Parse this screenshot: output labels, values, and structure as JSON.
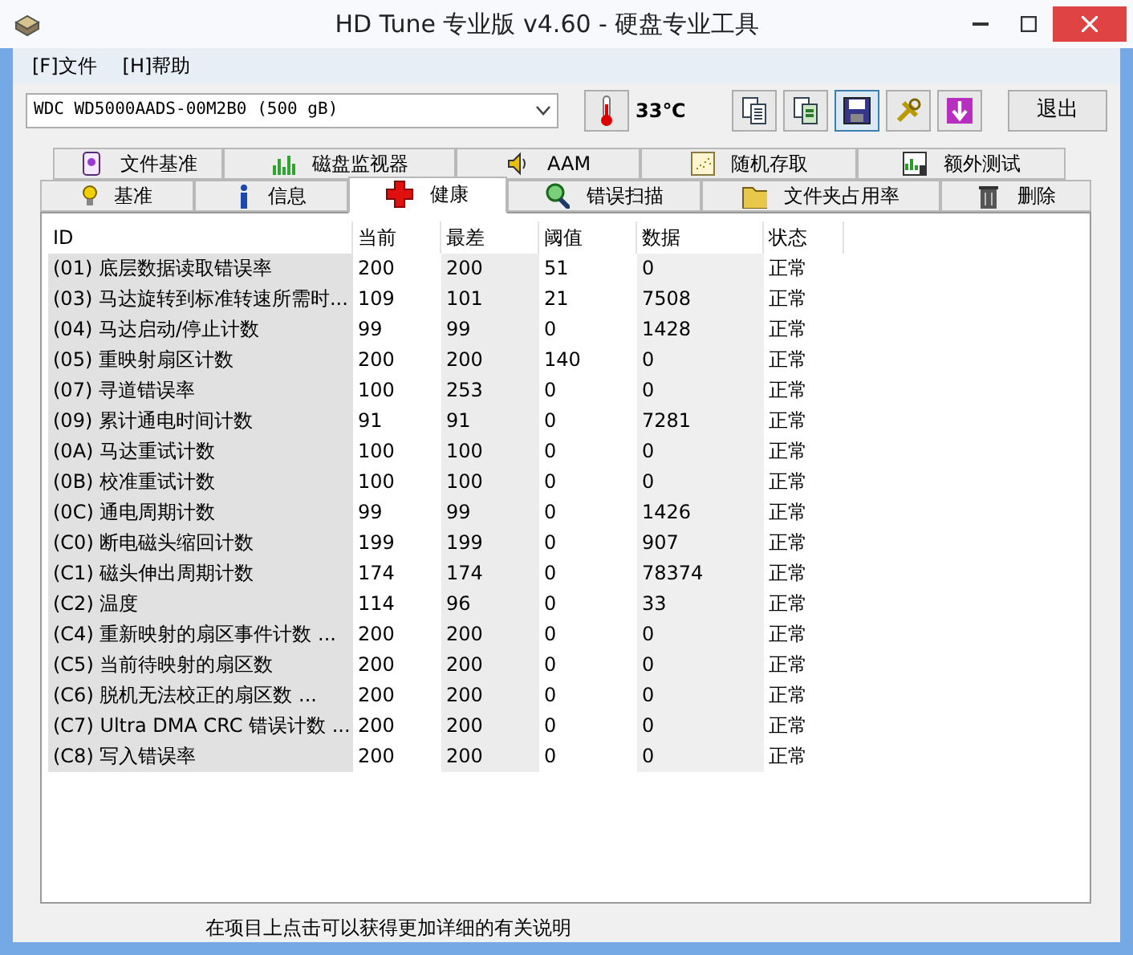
{
  "window": {
    "title": "HD Tune 专业版 v4.60 - 硬盘专业工具"
  },
  "menu": [
    {
      "label": "[F]文件"
    },
    {
      "label": "[H]帮助"
    }
  ],
  "toolbar": {
    "drive": "WDC WD5000AADS-00M2B0 (500 gB)",
    "temperature": "33℃",
    "exit_button": "退出"
  },
  "tab_rows": [
    {
      "tabs": [
        {
          "label": "文件基准",
          "selected": false
        },
        {
          "label": "磁盘监视器",
          "selected": false
        },
        {
          "label": "AAM",
          "selected": false
        },
        {
          "label": "随机存取",
          "selected": false
        },
        {
          "label": "额外测试",
          "selected": false
        }
      ]
    },
    {
      "tabs": [
        {
          "label": "基准",
          "selected": false
        },
        {
          "label": "信息",
          "selected": false
        },
        {
          "label": "健康",
          "selected": true
        },
        {
          "label": "错误扫描",
          "selected": false
        },
        {
          "label": "文件夹占用率",
          "selected": false
        },
        {
          "label": "删除",
          "selected": false
        }
      ]
    }
  ],
  "table": {
    "columns": [
      "ID",
      "当前",
      "最差",
      "阈值",
      "数据",
      "状态"
    ],
    "rows": [
      [
        "(01) 底层数据读取错误率",
        "200",
        "200",
        "51",
        "0",
        "正常"
      ],
      [
        "(03) 马达旋转到标准转速所需时...",
        "109",
        "101",
        "21",
        "7508",
        "正常"
      ],
      [
        "(04) 马达启动/停止计数",
        "99",
        "99",
        "0",
        "1428",
        "正常"
      ],
      [
        "(05) 重映射扇区计数",
        "200",
        "200",
        "140",
        "0",
        "正常"
      ],
      [
        "(07) 寻道错误率",
        "100",
        "253",
        "0",
        "0",
        "正常"
      ],
      [
        "(09) 累计通电时间计数",
        "91",
        "91",
        "0",
        "7281",
        "正常"
      ],
      [
        "(0A) 马达重试计数",
        "100",
        "100",
        "0",
        "0",
        "正常"
      ],
      [
        "(0B) 校准重试计数",
        "100",
        "100",
        "0",
        "0",
        "正常"
      ],
      [
        "(0C) 通电周期计数",
        "99",
        "99",
        "0",
        "1426",
        "正常"
      ],
      [
        "(C0) 断电磁头缩回计数",
        "199",
        "199",
        "0",
        "907",
        "正常"
      ],
      [
        "(C1) 磁头伸出周期计数",
        "174",
        "174",
        "0",
        "78374",
        "正常"
      ],
      [
        "(C2) 温度",
        "114",
        "96",
        "0",
        "33",
        "正常"
      ],
      [
        "(C4) 重新映射的扇区事件计数 ...",
        "200",
        "200",
        "0",
        "0",
        "正常"
      ],
      [
        "(C5) 当前待映射的扇区数",
        "200",
        "200",
        "0",
        "0",
        "正常"
      ],
      [
        "(C6) 脱机无法校正的扇区数 ...",
        "200",
        "200",
        "0",
        "0",
        "正常"
      ],
      [
        "(C7) Ultra DMA CRC 错误计数 ...",
        "200",
        "200",
        "0",
        "0",
        "正常"
      ],
      [
        "(C8) 写入错误率",
        "200",
        "200",
        "0",
        "0",
        "正常"
      ]
    ]
  },
  "footer_text": "在项目上点击可以获得更加详细的有关说明"
}
